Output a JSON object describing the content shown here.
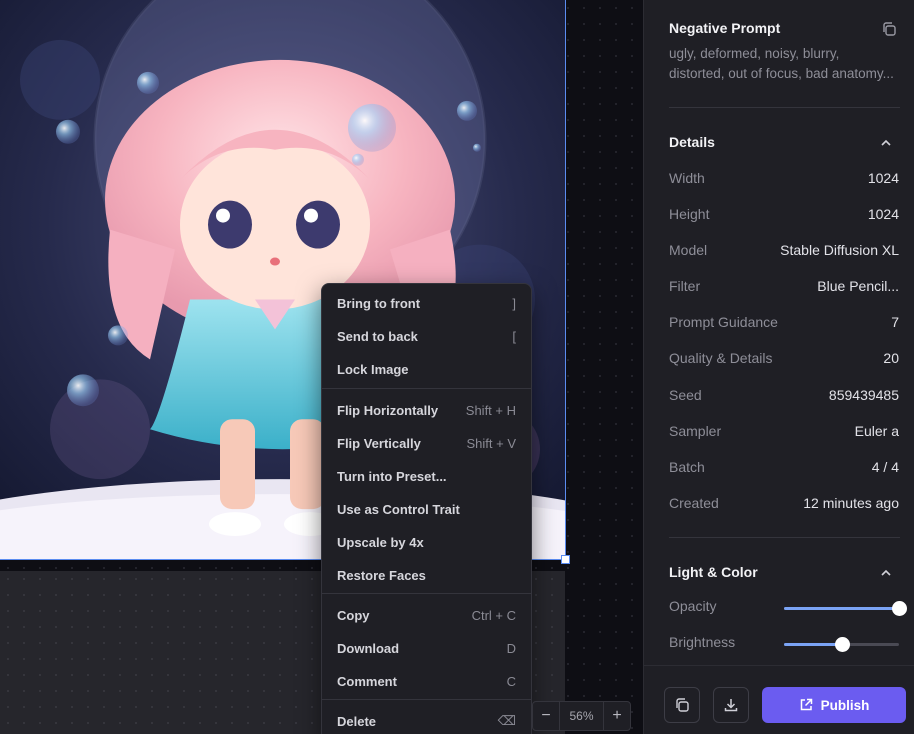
{
  "context_menu": {
    "items": [
      {
        "label": "Bring to front",
        "shortcut": "]"
      },
      {
        "label": "Send to back",
        "shortcut": "["
      },
      {
        "label": "Lock Image",
        "shortcut": ""
      },
      {
        "label": "Flip Horizontally",
        "shortcut": "Shift + H"
      },
      {
        "label": "Flip Vertically",
        "shortcut": "Shift + V"
      },
      {
        "label": "Turn into Preset...",
        "shortcut": ""
      },
      {
        "label": "Use as Control Trait",
        "shortcut": ""
      },
      {
        "label": "Upscale by 4x",
        "shortcut": ""
      },
      {
        "label": "Restore Faces",
        "shortcut": ""
      },
      {
        "label": "Copy",
        "shortcut": "Ctrl + C"
      },
      {
        "label": "Download",
        "shortcut": "D"
      },
      {
        "label": "Comment",
        "shortcut": "C"
      },
      {
        "label": "Delete",
        "shortcut": "⌫"
      }
    ]
  },
  "zoom": {
    "minus": "−",
    "value": "56%",
    "plus": "+"
  },
  "panel": {
    "negative_prompt": {
      "title": "Negative Prompt",
      "line1": "ugly, deformed, noisy, blurry,",
      "line2": "distorted, out of focus, bad anatomy..."
    },
    "details": {
      "title": "Details",
      "rows": [
        {
          "key": "Width",
          "value": "1024"
        },
        {
          "key": "Height",
          "value": "1024"
        },
        {
          "key": "Model",
          "value": "Stable Diffusion XL"
        },
        {
          "key": "Filter",
          "value": "Blue Pencil..."
        },
        {
          "key": "Prompt Guidance",
          "value": "7"
        },
        {
          "key": "Quality & Details",
          "value": "20"
        },
        {
          "key": "Seed",
          "value": "859439485"
        },
        {
          "key": "Sampler",
          "value": "Euler a"
        },
        {
          "key": "Batch",
          "value": "4 / 4"
        },
        {
          "key": "Created",
          "value": "12 minutes ago"
        }
      ]
    },
    "light_color": {
      "title": "Light & Color",
      "opacity_label": "Opacity",
      "opacity_value": 1.0,
      "brightness_label": "Brightness",
      "brightness_value": 0.5
    },
    "footer": {
      "publish_label": "Publish"
    }
  },
  "colors": {
    "accent": "#6b5cf0",
    "selection": "#5b8cf0",
    "slider_fill": "#7aa3f5"
  },
  "icons": [
    "copy-icon",
    "chevron-up-icon",
    "duplicate-icon",
    "download-icon",
    "external-link-icon",
    "backspace-icon"
  ]
}
